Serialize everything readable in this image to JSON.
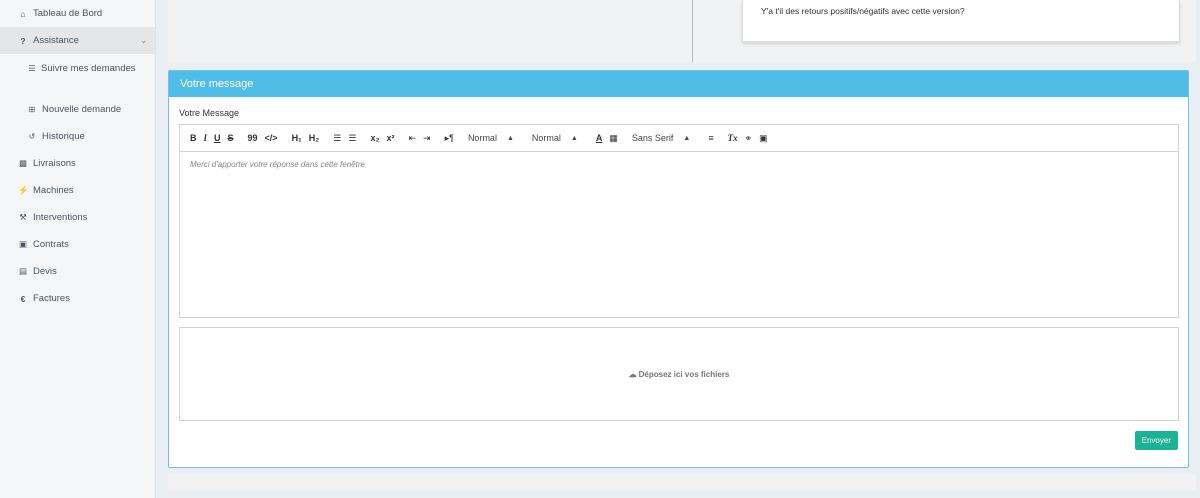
{
  "sidebar": {
    "items": [
      {
        "label": "Tableau de Bord",
        "icon": "home-icon"
      },
      {
        "label": "Assistance",
        "icon": "question-icon"
      },
      {
        "label": "Suivre mes demandes",
        "icon": "list-icon"
      },
      {
        "label": "Nouvelle demande",
        "icon": "plus-square-icon"
      },
      {
        "label": "Historique",
        "icon": "history-icon"
      },
      {
        "label": "Livraisons",
        "icon": "truck-icon"
      },
      {
        "label": "Machines",
        "icon": "plug-icon"
      },
      {
        "label": "Interventions",
        "icon": "wrench-icon"
      },
      {
        "label": "Contrats",
        "icon": "briefcase-icon"
      },
      {
        "label": "Devis",
        "icon": "cart-icon"
      },
      {
        "label": "Factures",
        "icon": "euro-icon"
      }
    ]
  },
  "top_card": {
    "text": "Y'a t'il des retours positifs/négatifs avec cette version?"
  },
  "panel": {
    "title": "Votre message",
    "field_label": "Votre Message",
    "placeholder": "Merci d'apporter votre réponse dans cette fenêtre",
    "dropzone_text": "Déposez ici vos fichiers",
    "send_label": "Envoyer"
  },
  "toolbar": {
    "bold": "B",
    "italic": "I",
    "underline": "U",
    "strike": "S",
    "quote": "99",
    "code": "</>",
    "h1": "H₁",
    "h2": "H₂",
    "sub": "x₂",
    "sup": "x²",
    "direction": "▸¶",
    "size_value": "Normal",
    "header_value": "Normal",
    "font_value": "Sans Serif",
    "clean": "Tx"
  },
  "colors": {
    "panel_header": "#4fbde8",
    "send_button": "#1ab394"
  }
}
